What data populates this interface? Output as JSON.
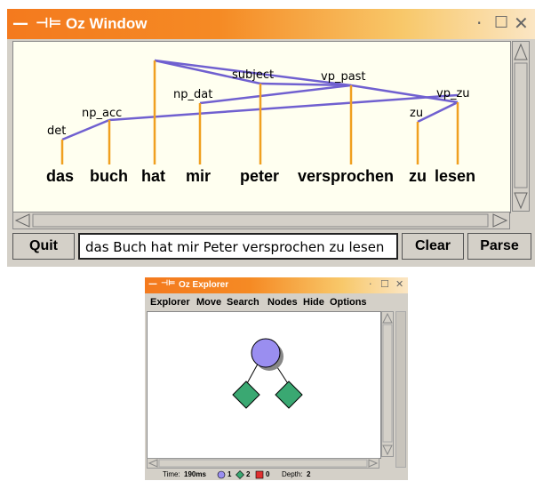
{
  "oz_window": {
    "title": "Oz Window",
    "words": [
      "das",
      "buch",
      "hat",
      "mir",
      "peter",
      "versprochen",
      "zu",
      "lesen"
    ],
    "edge_labels": [
      "det",
      "np_acc",
      "np_dat",
      "subject",
      "vp_past",
      "vp_zu",
      "zu"
    ],
    "quit_label": "Quit",
    "input_value": "das Buch hat mir Peter versprochen zu lesen",
    "clear_label": "Clear",
    "parse_label": "Parse",
    "colors": {
      "edge": "#7060d0",
      "projection": "#f0a020",
      "titlebar": "#f47a1e"
    }
  },
  "oz_explorer": {
    "title": "Oz Explorer",
    "menu": [
      "Explorer",
      "Move",
      "Search",
      "Nodes",
      "Hide",
      "Options"
    ],
    "status": {
      "time_label": "Time:",
      "time_value": "190ms",
      "choice_count": "1",
      "solution_count": "2",
      "failure_count": "0",
      "depth_label": "Depth:",
      "depth_value": "2"
    },
    "colors": {
      "choice_node": "#9a8ef0",
      "solution_node": "#3aa872",
      "failure_node": "#e03030"
    }
  }
}
